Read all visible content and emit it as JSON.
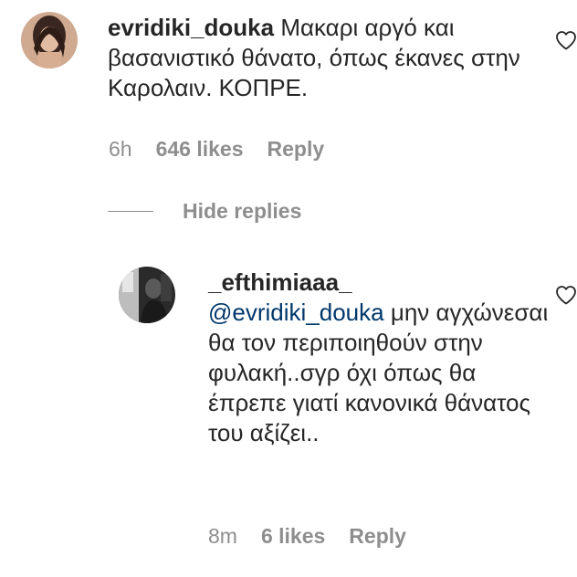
{
  "comments": [
    {
      "username": "evridiki_douka",
      "text": "Μακαρι αργό και βασανιστικό θάνατο, όπως έκανες στην Καρολαιν. ΚΟΠΡΕ.",
      "time": "6h",
      "likes": "646 likes",
      "reply_label": "Reply",
      "avatar_icon": "user-avatar-photo",
      "like_icon": "heart-outline-icon"
    }
  ],
  "hide_replies_label": "Hide replies",
  "replies": [
    {
      "username": "_efthimiaaa_",
      "mention": "@evridiki_douka",
      "text": "μην αγχώνεσαι θα τον περιποιηθούν στην φυλακή..σγρ όχι όπως θα έπρεπε γιατί κανονικά θάνατος του αξίζει..",
      "time": "8m",
      "likes": "6 likes",
      "reply_label": "Reply",
      "avatar_icon": "user-avatar-photo",
      "like_icon": "heart-outline-icon"
    }
  ],
  "colors": {
    "text": "#262626",
    "secondary": "#8e8e8e",
    "mention": "#00376b"
  }
}
